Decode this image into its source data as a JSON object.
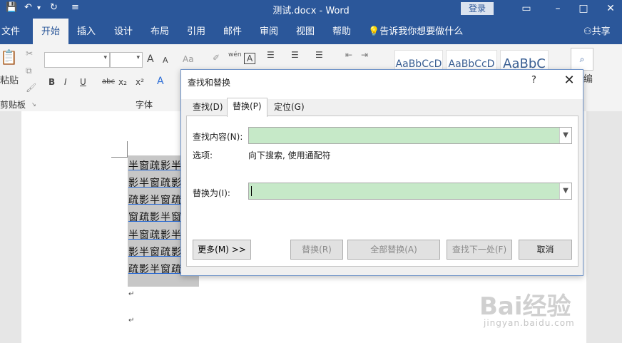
{
  "titlebar": {
    "title": "测试.docx  -  Word",
    "login": "登录",
    "quick_access": {
      "save": "💾",
      "undo": "↶",
      "undo_drop": "▾",
      "redo": "↻",
      "customize": "≡"
    },
    "controls": {
      "minimize": "–",
      "restore": "□",
      "close": "✕"
    }
  },
  "ribbon_tabs": [
    "文件",
    "开始",
    "插入",
    "设计",
    "布局",
    "引用",
    "邮件",
    "审阅",
    "视图",
    "帮助"
  ],
  "active_tab": "开始",
  "tell_me": "告诉我你想要做什么",
  "share": "共享",
  "ribbon": {
    "paste": "粘贴",
    "clipboard": "剪贴板",
    "font_group": "字体",
    "font_buttons": [
      "B",
      "I",
      "U",
      "abc",
      "x₂",
      "x²"
    ],
    "grow_font": "A",
    "shrink_font": "A",
    "change_case": "Aa",
    "styles": [
      "AaBbCcD",
      "AaBbCcD",
      "AaBbC"
    ],
    "edit_label": "编"
  },
  "document": {
    "lines": [
      "半窗疏影半",
      "影半窗疏影",
      "疏影半窗疏",
      "窗疏影半窗",
      "半窗疏影半",
      "影半窗疏影",
      "疏影半窗疏"
    ],
    "paragraph_mark": "↵"
  },
  "dialog": {
    "title": "查找和替换",
    "help": "?",
    "close": "✕",
    "tabs": [
      "查找(D)",
      "替换(P)",
      "定位(G)"
    ],
    "active_tab": "替换(P)",
    "find_label": "查找内容(N):",
    "find_value": "",
    "options_label": "选项:",
    "options_value": "向下搜索, 使用通配符",
    "replace_label": "替换为(I):",
    "replace_value": "",
    "buttons": {
      "more": "更多(M) >>",
      "replace": "替换(R)",
      "replace_all": "全部替换(A)",
      "find_next": "查找下一处(F)",
      "cancel": "取消"
    }
  },
  "watermark": {
    "brand": "Bai经验",
    "url": "jingyan.baidu.com"
  },
  "colors": {
    "accent": "#2b579a",
    "combo_fill": "#c6e9c8",
    "selection": "#c7c7c7"
  }
}
